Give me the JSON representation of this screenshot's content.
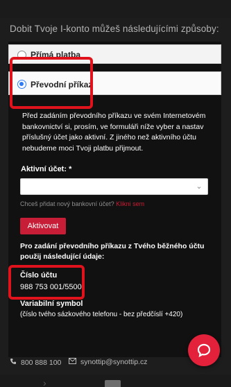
{
  "intro_text": "Dobit Tvoje I-konto můžeš následujícími způsoby:",
  "options": [
    {
      "label": "Přímá platba",
      "selected": false
    },
    {
      "label": "Převodní příkaz",
      "selected": true
    }
  ],
  "info_text": "Před zadáním převodního příkazu ve svém Internetovém bankovnictví si, prosím, ve formuláři níže vyber a nastav příslušný účet jako aktivní. Z jiného než aktivního účtu nebudeme moci Tvoji platbu přijmout.",
  "active_account": {
    "label": "Aktivní účet: *",
    "value": "",
    "hint": "Chceš přidat nový bankovní účet?",
    "hint_link": "Klikni sem"
  },
  "activate_button": "Aktivovat",
  "transfer_info": "Pro zadání převodního příkazu z Tvého běžného účtu použij následující údaje:",
  "account_number": {
    "label": "Číslo účtu",
    "value": "988 753 001/5500"
  },
  "variable_symbol": {
    "label": "Variabilní symbol",
    "value": "(číslo tvého sázkového telefonu - bez předčíslí +420)"
  },
  "footer": {
    "phone": "800 888 100",
    "email": "synottip@synottip.cz"
  },
  "colors": {
    "accent": "#c81d36",
    "annotation": "#e0131c",
    "radio": "#2d7cf6"
  },
  "icons": {
    "phone": "phone-icon",
    "email": "email-icon",
    "chat": "chat-icon",
    "dropdown": "chevron-down-icon"
  }
}
